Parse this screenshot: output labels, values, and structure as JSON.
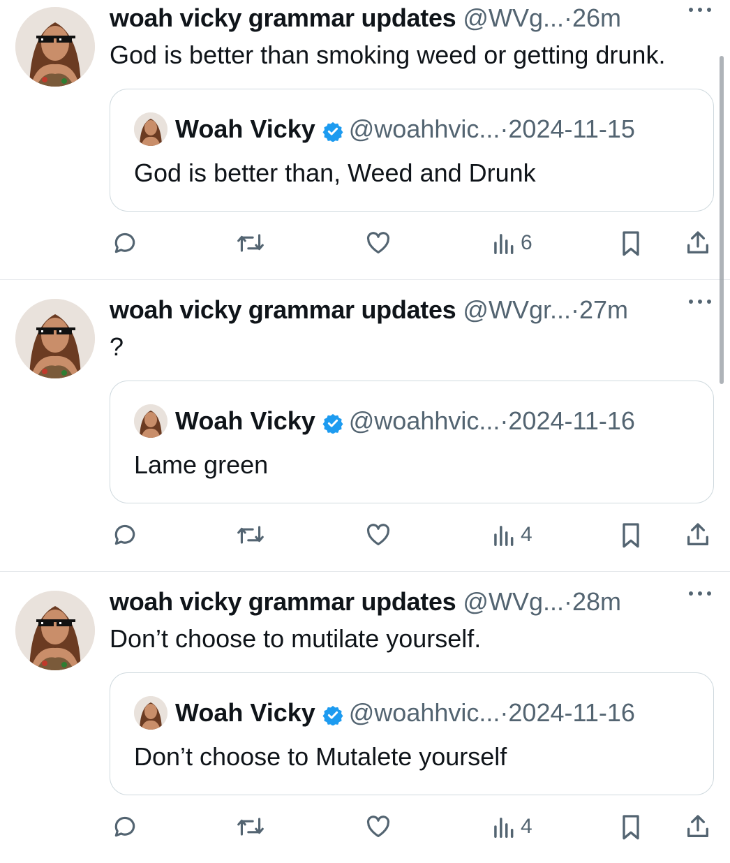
{
  "colors": {
    "text_primary": "#0f1419",
    "text_secondary": "#536471",
    "verified_blue": "#1d9bf0",
    "border": "#cfd9de"
  },
  "icons": {
    "avatar": "avatar-with-pixel-sunglasses",
    "more": "more-horizontal-icon",
    "verified": "verified-badge-icon",
    "reply": "reply-icon",
    "retweet": "retweet-icon",
    "like": "heart-icon",
    "views": "views-icon",
    "bookmark": "bookmark-icon",
    "share": "share-icon"
  },
  "tweets": [
    {
      "display_name": "woah vicky grammar updates",
      "handle": "@WVg...",
      "dot": "·",
      "time": "26m",
      "text": "God is better than smoking weed or getting drunk.",
      "quote": {
        "display_name": "Woah Vicky",
        "handle": "@woahhvic...",
        "dot": "·",
        "date": "2024-11-15",
        "text": "God is better than, Weed and Drunk"
      },
      "views": "6"
    },
    {
      "display_name": "woah vicky grammar updates",
      "handle": "@WVgr...",
      "dot": "·",
      "time": "27m",
      "text": "?",
      "quote": {
        "display_name": "Woah Vicky",
        "handle": "@woahhvic...",
        "dot": "·",
        "date": "2024-11-16",
        "text": "Lame  green"
      },
      "views": "4"
    },
    {
      "display_name": "woah vicky grammar updates",
      "handle": "@WVg...",
      "dot": "·",
      "time": "28m",
      "text": "Don’t choose to mutilate yourself.",
      "quote": {
        "display_name": "Woah Vicky",
        "handle": "@woahhvic...",
        "dot": "·",
        "date": "2024-11-16",
        "text": "Don’t choose to Mutalete yourself"
      },
      "views": "4"
    }
  ]
}
